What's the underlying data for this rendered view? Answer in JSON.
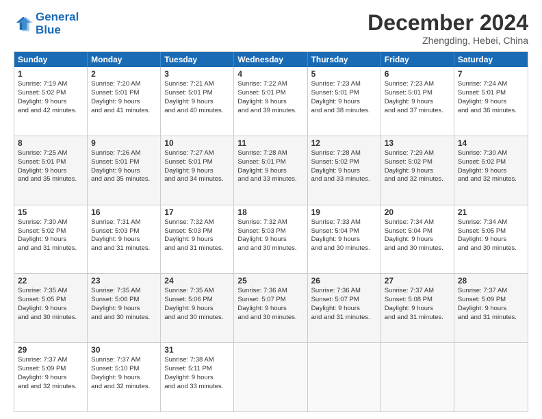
{
  "logo": {
    "line1": "General",
    "line2": "Blue"
  },
  "header": {
    "month_year": "December 2024",
    "location": "Zhengding, Hebei, China"
  },
  "weekdays": [
    "Sunday",
    "Monday",
    "Tuesday",
    "Wednesday",
    "Thursday",
    "Friday",
    "Saturday"
  ],
  "weeks": [
    [
      {
        "day": "1",
        "sunrise": "7:19 AM",
        "sunset": "5:02 PM",
        "daylight": "9 hours and 42 minutes."
      },
      {
        "day": "2",
        "sunrise": "7:20 AM",
        "sunset": "5:01 PM",
        "daylight": "9 hours and 41 minutes."
      },
      {
        "day": "3",
        "sunrise": "7:21 AM",
        "sunset": "5:01 PM",
        "daylight": "9 hours and 40 minutes."
      },
      {
        "day": "4",
        "sunrise": "7:22 AM",
        "sunset": "5:01 PM",
        "daylight": "9 hours and 39 minutes."
      },
      {
        "day": "5",
        "sunrise": "7:23 AM",
        "sunset": "5:01 PM",
        "daylight": "9 hours and 38 minutes."
      },
      {
        "day": "6",
        "sunrise": "7:23 AM",
        "sunset": "5:01 PM",
        "daylight": "9 hours and 37 minutes."
      },
      {
        "day": "7",
        "sunrise": "7:24 AM",
        "sunset": "5:01 PM",
        "daylight": "9 hours and 36 minutes."
      }
    ],
    [
      {
        "day": "8",
        "sunrise": "7:25 AM",
        "sunset": "5:01 PM",
        "daylight": "9 hours and 35 minutes."
      },
      {
        "day": "9",
        "sunrise": "7:26 AM",
        "sunset": "5:01 PM",
        "daylight": "9 hours and 35 minutes."
      },
      {
        "day": "10",
        "sunrise": "7:27 AM",
        "sunset": "5:01 PM",
        "daylight": "9 hours and 34 minutes."
      },
      {
        "day": "11",
        "sunrise": "7:28 AM",
        "sunset": "5:01 PM",
        "daylight": "9 hours and 33 minutes."
      },
      {
        "day": "12",
        "sunrise": "7:28 AM",
        "sunset": "5:02 PM",
        "daylight": "9 hours and 33 minutes."
      },
      {
        "day": "13",
        "sunrise": "7:29 AM",
        "sunset": "5:02 PM",
        "daylight": "9 hours and 32 minutes."
      },
      {
        "day": "14",
        "sunrise": "7:30 AM",
        "sunset": "5:02 PM",
        "daylight": "9 hours and 32 minutes."
      }
    ],
    [
      {
        "day": "15",
        "sunrise": "7:30 AM",
        "sunset": "5:02 PM",
        "daylight": "9 hours and 31 minutes."
      },
      {
        "day": "16",
        "sunrise": "7:31 AM",
        "sunset": "5:03 PM",
        "daylight": "9 hours and 31 minutes."
      },
      {
        "day": "17",
        "sunrise": "7:32 AM",
        "sunset": "5:03 PM",
        "daylight": "9 hours and 31 minutes."
      },
      {
        "day": "18",
        "sunrise": "7:32 AM",
        "sunset": "5:03 PM",
        "daylight": "9 hours and 30 minutes."
      },
      {
        "day": "19",
        "sunrise": "7:33 AM",
        "sunset": "5:04 PM",
        "daylight": "9 hours and 30 minutes."
      },
      {
        "day": "20",
        "sunrise": "7:34 AM",
        "sunset": "5:04 PM",
        "daylight": "9 hours and 30 minutes."
      },
      {
        "day": "21",
        "sunrise": "7:34 AM",
        "sunset": "5:05 PM",
        "daylight": "9 hours and 30 minutes."
      }
    ],
    [
      {
        "day": "22",
        "sunrise": "7:35 AM",
        "sunset": "5:05 PM",
        "daylight": "9 hours and 30 minutes."
      },
      {
        "day": "23",
        "sunrise": "7:35 AM",
        "sunset": "5:06 PM",
        "daylight": "9 hours and 30 minutes."
      },
      {
        "day": "24",
        "sunrise": "7:35 AM",
        "sunset": "5:06 PM",
        "daylight": "9 hours and 30 minutes."
      },
      {
        "day": "25",
        "sunrise": "7:36 AM",
        "sunset": "5:07 PM",
        "daylight": "9 hours and 30 minutes."
      },
      {
        "day": "26",
        "sunrise": "7:36 AM",
        "sunset": "5:07 PM",
        "daylight": "9 hours and 31 minutes."
      },
      {
        "day": "27",
        "sunrise": "7:37 AM",
        "sunset": "5:08 PM",
        "daylight": "9 hours and 31 minutes."
      },
      {
        "day": "28",
        "sunrise": "7:37 AM",
        "sunset": "5:09 PM",
        "daylight": "9 hours and 31 minutes."
      }
    ],
    [
      {
        "day": "29",
        "sunrise": "7:37 AM",
        "sunset": "5:09 PM",
        "daylight": "9 hours and 32 minutes."
      },
      {
        "day": "30",
        "sunrise": "7:37 AM",
        "sunset": "5:10 PM",
        "daylight": "9 hours and 32 minutes."
      },
      {
        "day": "31",
        "sunrise": "7:38 AM",
        "sunset": "5:11 PM",
        "daylight": "9 hours and 33 minutes."
      },
      null,
      null,
      null,
      null
    ]
  ]
}
